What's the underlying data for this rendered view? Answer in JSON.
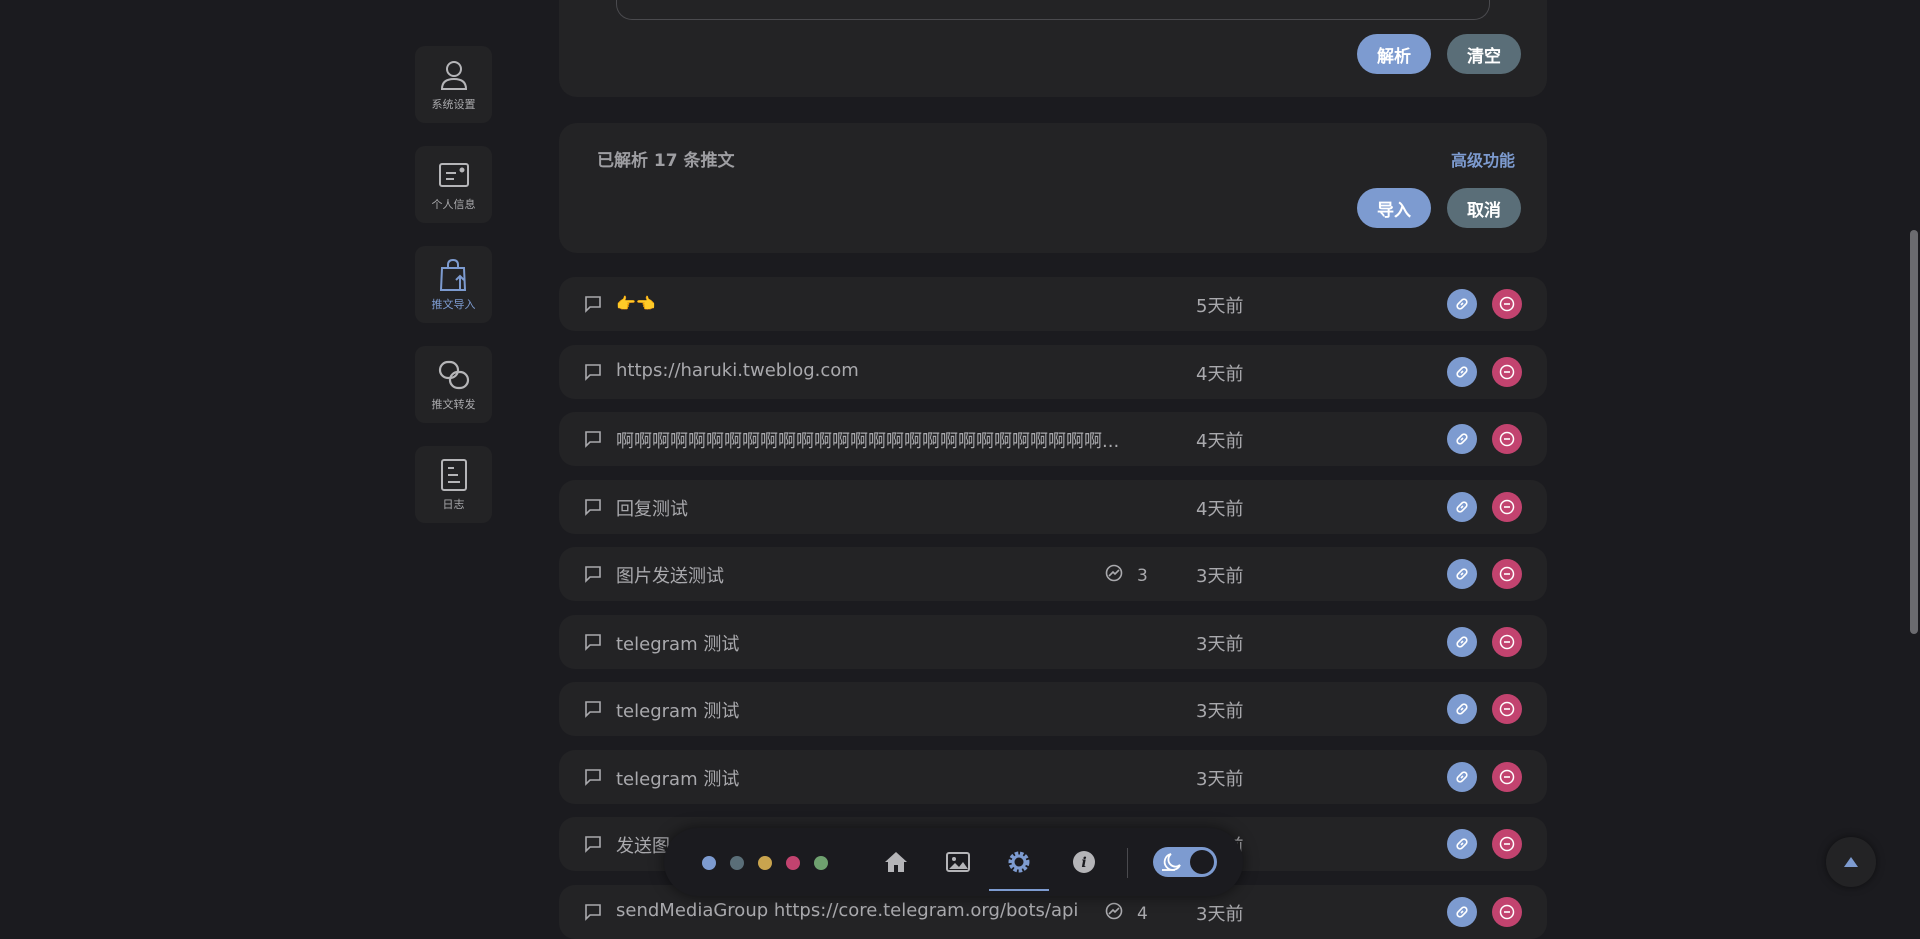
{
  "sidebar": {
    "items": [
      {
        "label": "系统设置",
        "icon": "user-icon"
      },
      {
        "label": "个人信息",
        "icon": "id-card-icon"
      },
      {
        "label": "推文导入",
        "icon": "bag-upload-icon",
        "active": true
      },
      {
        "label": "推文转发",
        "icon": "link-circles-icon"
      },
      {
        "label": "日志",
        "icon": "document-icon"
      }
    ]
  },
  "parse": {
    "parse_label": "解析",
    "clear_label": "清空"
  },
  "parsed": {
    "title": "已解析 17 条推文",
    "advanced_label": "高级功能",
    "import_label": "导入",
    "cancel_label": "取消"
  },
  "tweets": [
    {
      "text": "👉👈",
      "time": "5天前"
    },
    {
      "text": "https://haruki.tweblog.com",
      "time": "4天前"
    },
    {
      "text": "啊啊啊啊啊啊啊啊啊啊啊啊啊啊啊啊啊啊啊啊啊啊啊啊啊啊啊...",
      "time": "4天前"
    },
    {
      "text": "回复测试",
      "time": "4天前"
    },
    {
      "text": "图片发送测试",
      "media": "3",
      "time": "3天前"
    },
    {
      "text": "telegram 测试",
      "time": "3天前"
    },
    {
      "text": "telegram 测试",
      "time": "3天前"
    },
    {
      "text": "telegram 测试",
      "time": "3天前"
    },
    {
      "text": "发送图",
      "time": "3天前"
    },
    {
      "text": "sendMediaGroup https://core.telegram.org/bots/api",
      "media": "4",
      "time": "3天前"
    }
  ],
  "dock": {
    "theme_dots": [
      "#7d9bd0",
      "#5a6e78",
      "#c9a44e",
      "#c2436f",
      "#6fa16f"
    ],
    "icons": [
      "home-icon",
      "image-icon",
      "gear-icon",
      "info-icon"
    ],
    "active_icon": "gear-icon",
    "dark_mode": true
  },
  "colors": {
    "accent": "#7d9bd0",
    "danger": "#c2436f",
    "secondary": "#5a6e78"
  }
}
